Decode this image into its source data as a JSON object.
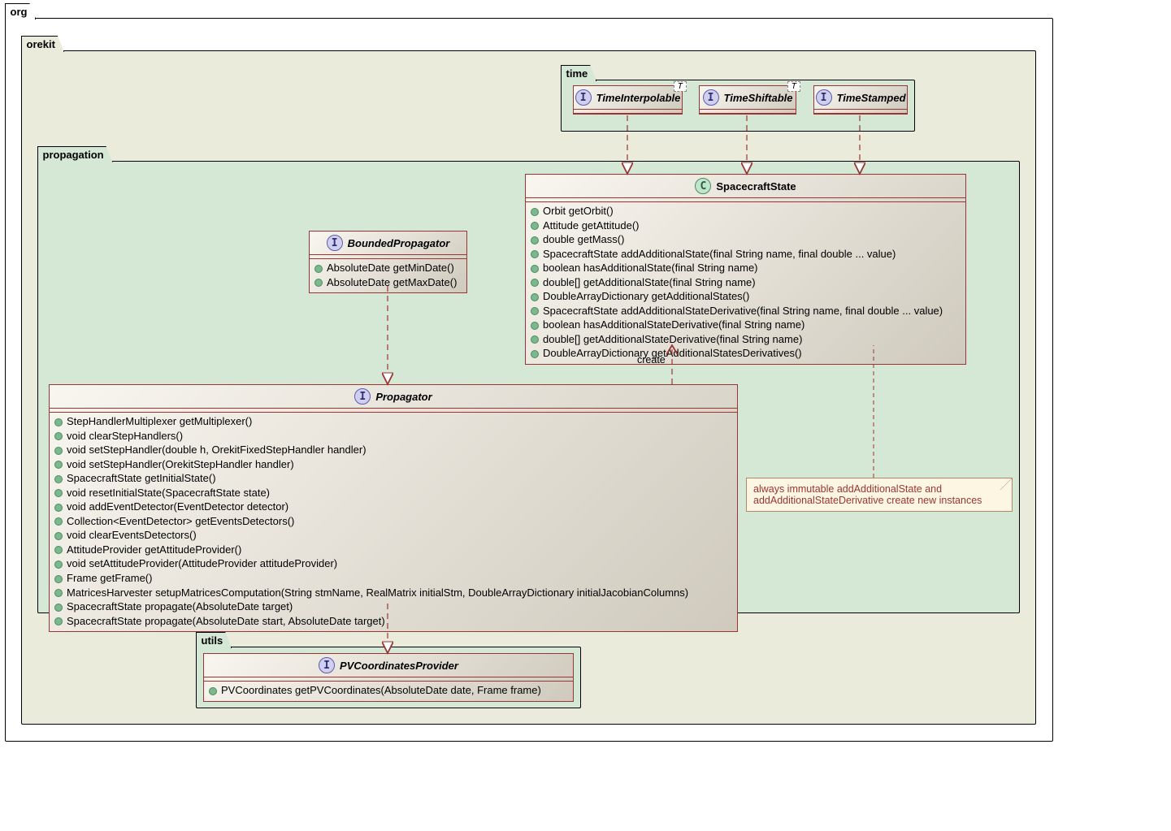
{
  "packages": {
    "org": {
      "label": "org"
    },
    "orekit": {
      "label": "orekit"
    },
    "time": {
      "label": "time"
    },
    "propagation": {
      "label": "propagation"
    },
    "utils": {
      "label": "utils"
    }
  },
  "time": {
    "interpolable": {
      "title": "TimeInterpolable",
      "generic": "T"
    },
    "shiftable": {
      "title": "TimeShiftable",
      "generic": "T"
    },
    "stamped": {
      "title": "TimeStamped"
    }
  },
  "boundedPropagator": {
    "title": "BoundedPropagator",
    "members": [
      "AbsoluteDate getMinDate()",
      "AbsoluteDate getMaxDate()"
    ]
  },
  "spacecraftState": {
    "title": "SpacecraftState",
    "members": [
      "Orbit getOrbit()",
      "Attitude getAttitude()",
      "double getMass()",
      "SpacecraftState addAdditionalState(final String name, final double ... value)",
      "boolean hasAdditionalState(final String name)",
      "double[] getAdditionalState(final String name)",
      "DoubleArrayDictionary getAdditionalStates()",
      "SpacecraftState addAdditionalStateDerivative(final String name, final double ... value)",
      "boolean hasAdditionalStateDerivative(final String name)",
      "double[] getAdditionalStateDerivative(final String name)",
      "DoubleArrayDictionary getAdditionalStatesDerivatives()"
    ]
  },
  "propagator": {
    "title": "Propagator",
    "members": [
      "StepHandlerMultiplexer getMultiplexer()",
      "void clearStepHandlers()",
      "void setStepHandler(double h, OrekitFixedStepHandler handler)",
      "void setStepHandler(OrekitStepHandler handler)",
      "SpacecraftState getInitialState()",
      "void resetInitialState(SpacecraftState state)",
      "void addEventDetector(EventDetector detector)",
      "Collection<EventDetector> getEventsDetectors()",
      "void clearEventsDetectors()",
      "AttitudeProvider getAttitudeProvider()",
      "void setAttitudeProvider(AttitudeProvider attitudeProvider)",
      "Frame getFrame()",
      "MatricesHarvester setupMatricesComputation(String stmName, RealMatrix initialStm, DoubleArrayDictionary initialJacobianColumns)",
      "SpacecraftState propagate(AbsoluteDate target)",
      "SpacecraftState propagate(AbsoluteDate start, AbsoluteDate target)"
    ]
  },
  "pvProvider": {
    "title": "PVCoordinatesProvider",
    "members": [
      "PVCoordinates getPVCoordinates(AbsoluteDate date, Frame frame)"
    ]
  },
  "note": {
    "text": "always immutable addAdditionalState and addAdditionalStateDerivative create new instances"
  },
  "edges": {
    "create": "create"
  }
}
